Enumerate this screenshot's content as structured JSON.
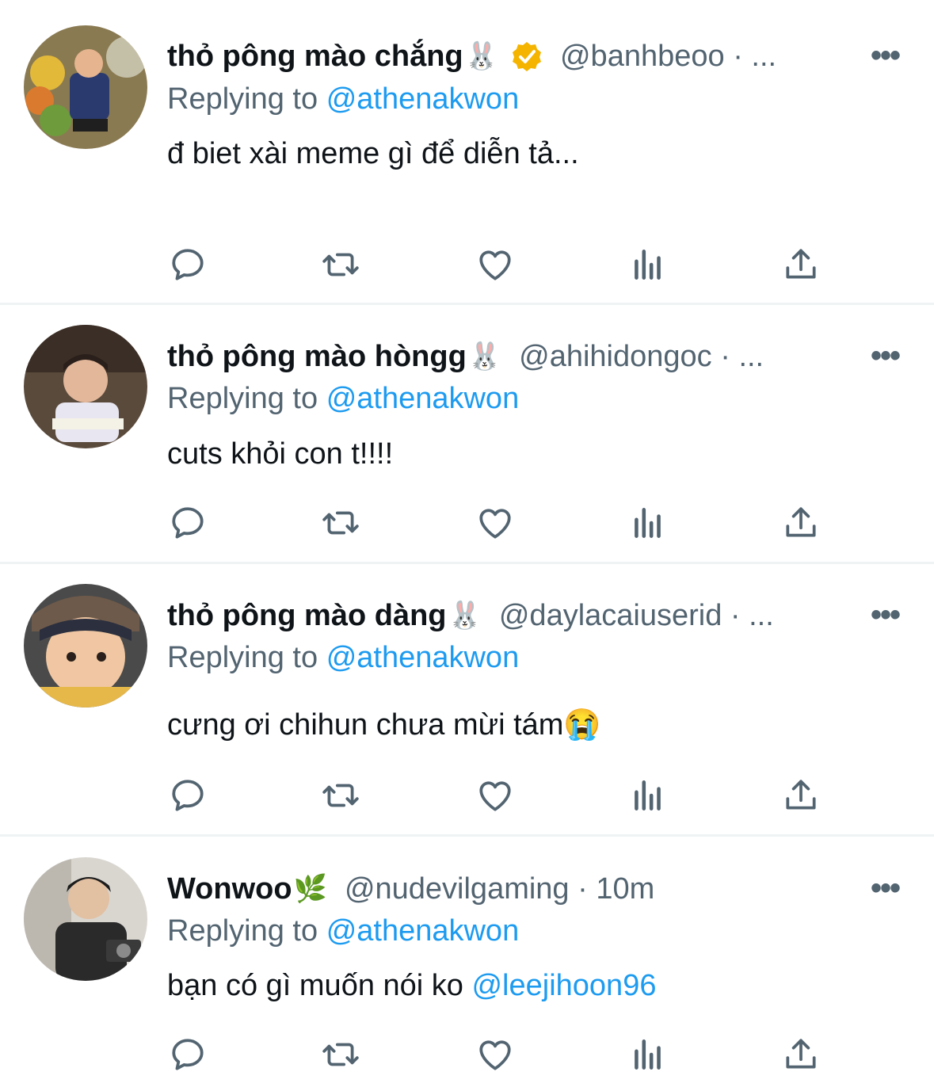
{
  "tweets": [
    {
      "name": "thỏ pông mào chắng",
      "emoji": "🐰",
      "verified": true,
      "handle": "@banhbeoo · ...",
      "reply_prefix": "Replying to",
      "reply_to": "@athenakwon",
      "text": "đ biet xài meme gì để diễn tả...",
      "text_mention": ""
    },
    {
      "name": "thỏ pông mào hòngg",
      "emoji": "🐰",
      "verified": false,
      "handle": "@ahihidongoc · ...",
      "reply_prefix": "Replying to",
      "reply_to": "@athenakwon",
      "text": "cuts khỏi con t!!!!",
      "text_mention": ""
    },
    {
      "name": "thỏ pông mào dàng",
      "emoji": "🐰",
      "verified": false,
      "handle": "@daylacaiuserid · ...",
      "reply_prefix": "Replying to",
      "reply_to": "@athenakwon",
      "text": "cưng ơi chihun chưa mừi tám😭",
      "text_mention": ""
    },
    {
      "name": "Wonwoo",
      "emoji": "🌿",
      "verified": false,
      "handle": "@nudevilgaming · 10m",
      "reply_prefix": "Replying to",
      "reply_to": "@athenakwon",
      "text": "bạn có gì muốn nói ko ",
      "text_mention": "@leejihoon96"
    }
  ],
  "more_label": "•••",
  "icons": [
    "reply-icon",
    "retweet-icon",
    "like-icon",
    "views-icon",
    "share-icon"
  ],
  "colors": {
    "accent": "#1d9bf0",
    "muted": "#536471",
    "badge": "#f4b400"
  }
}
